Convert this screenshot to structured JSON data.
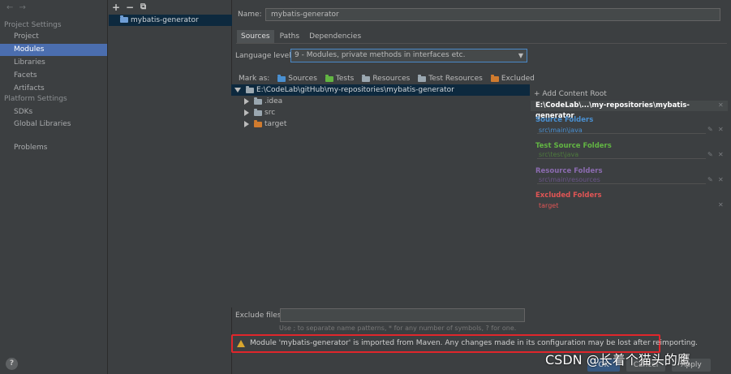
{
  "nav": {
    "arrows": "← →"
  },
  "sidebar": {
    "section_project": "Project Settings",
    "project_items": [
      {
        "label": "Project"
      },
      {
        "label": "Modules"
      },
      {
        "label": "Libraries"
      },
      {
        "label": "Facets"
      },
      {
        "label": "Artifacts"
      }
    ],
    "section_platform": "Platform Settings",
    "platform_items": [
      {
        "label": "SDKs"
      },
      {
        "label": "Global Libraries"
      }
    ],
    "problems": "Problems",
    "help": "?"
  },
  "module_list": {
    "toolbar": {
      "add": "+",
      "remove": "−",
      "copy": "⧉"
    },
    "items": [
      {
        "label": "mybatis-generator"
      }
    ]
  },
  "detail": {
    "name_label": "Name:",
    "name_value": "mybatis-generator",
    "tabs": [
      {
        "label": "Sources"
      },
      {
        "label": "Paths"
      },
      {
        "label": "Dependencies"
      }
    ],
    "language_level_label": "Language level:",
    "language_level_value": "9 - Modules, private methods in interfaces etc.",
    "mark_as_label": "Mark as:",
    "mark_as": [
      {
        "label": "Sources"
      },
      {
        "label": "Tests"
      },
      {
        "label": "Resources"
      },
      {
        "label": "Test Resources"
      },
      {
        "label": "Excluded"
      }
    ],
    "tree": {
      "root": "E:\\CodeLab\\gitHub\\my-repositories\\mybatis-generator",
      "children": [
        {
          "label": ".idea"
        },
        {
          "label": "src"
        },
        {
          "label": "target"
        }
      ]
    },
    "content_root": {
      "add_label": "+ Add Content Root",
      "root_path": "E:\\CodeLab\\...\\my-repositories\\mybatis-generator",
      "source_folders_heading": "Source Folders",
      "source_folders_path": "src\\main\\java",
      "test_folders_heading": "Test Source Folders",
      "test_folders_path": "src\\test\\java",
      "resource_folders_heading": "Resource Folders",
      "resource_folders_path": "src\\main\\resources",
      "excluded_folders_heading": "Excluded Folders",
      "excluded_folders_path": "target"
    },
    "exclude_files_label": "Exclude files:",
    "exclude_hint": "Use ; to separate name patterns, * for any number of symbols, ? for one.",
    "warning": "Module 'mybatis-generator' is imported from Maven. Any changes made in its configuration may be lost after reimporting."
  },
  "footer": {
    "ok": "OK",
    "cancel": "Cancel",
    "apply": "Apply"
  },
  "watermark": "CSDN @长着个猫头的鹰",
  "colors": {
    "selection": "#4b6eaf",
    "source": "#4a90d1",
    "test": "#62b543",
    "resource": "#8b6bb0",
    "excluded": "#e05555",
    "warning_border": "#e0262b"
  }
}
